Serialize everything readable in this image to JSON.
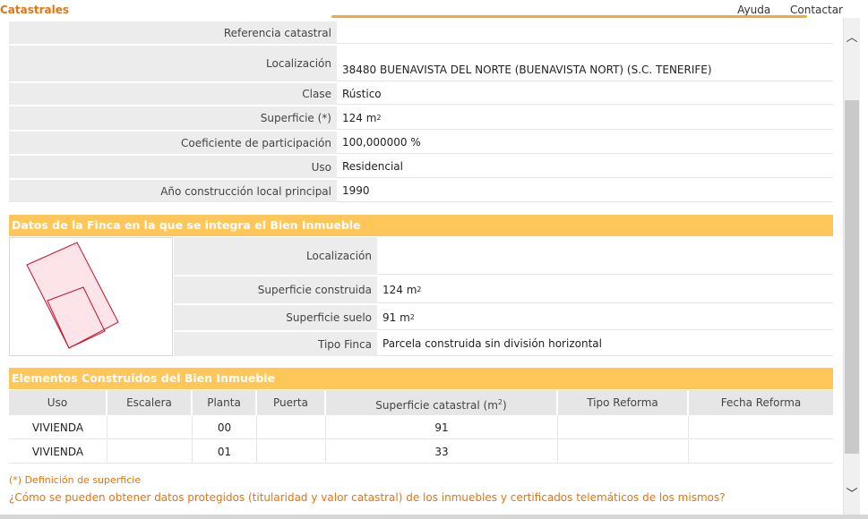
{
  "header": {
    "title": "Catastrales",
    "links": [
      "Ayuda",
      "Contactar"
    ]
  },
  "inmueble": {
    "rows": [
      {
        "label": "Referencia catastral",
        "value": ""
      },
      {
        "label": "Localización",
        "value": "38480 BUENAVISTA DEL NORTE (BUENAVISTA NORT) (S.C. TENERIFE)"
      },
      {
        "label": "Clase",
        "value": "Rústico"
      },
      {
        "label": "Superficie (*)",
        "value": "124 m",
        "sup": "2"
      },
      {
        "label": "Coeficiente de participación",
        "value": "100,000000 %"
      },
      {
        "label": "Uso",
        "value": "Residencial"
      },
      {
        "label": "Año construcción local principal",
        "value": "1990"
      }
    ]
  },
  "finca": {
    "title": "Datos de la Finca en la que se integra el Bien Inmueble",
    "rows": [
      {
        "label": "Localización",
        "value": ""
      },
      {
        "label": "Superficie construida",
        "value": "124 m",
        "sup": "2"
      },
      {
        "label": "Superficie suelo",
        "value": "91 m",
        "sup": "2"
      },
      {
        "label": "Tipo Finca",
        "value": "Parcela construida sin división horizontal"
      }
    ]
  },
  "elementos": {
    "title": "Elementos Construidos del Bien Inmueble",
    "headers": [
      "Uso",
      "Escalera",
      "Planta",
      "Puerta",
      "Superficie catastral (m",
      "Tipo Reforma",
      "Fecha Reforma"
    ],
    "header_sup": "2",
    "header_suffix": ")",
    "rows": [
      [
        "VIVIENDA",
        "",
        "00",
        "",
        "91",
        "",
        ""
      ],
      [
        "VIVIENDA",
        "",
        "01",
        "",
        "33",
        "",
        ""
      ]
    ]
  },
  "footer": {
    "definicion": "(*) Definición de superficie",
    "question": "¿Cómo se pueden obtener datos protegidos (titularidad y valor catastral) de los inmuebles y certificados telemáticos de los mismos?"
  },
  "colors": {
    "accent_orange": "#e8730c",
    "section_bg": "#ffc65a",
    "plot_stroke": "#c8102e",
    "plot_fill": "#fde4e8"
  },
  "icons": {
    "scroll_up": "chevron-up-icon",
    "scroll_down": "chevron-down-icon"
  }
}
